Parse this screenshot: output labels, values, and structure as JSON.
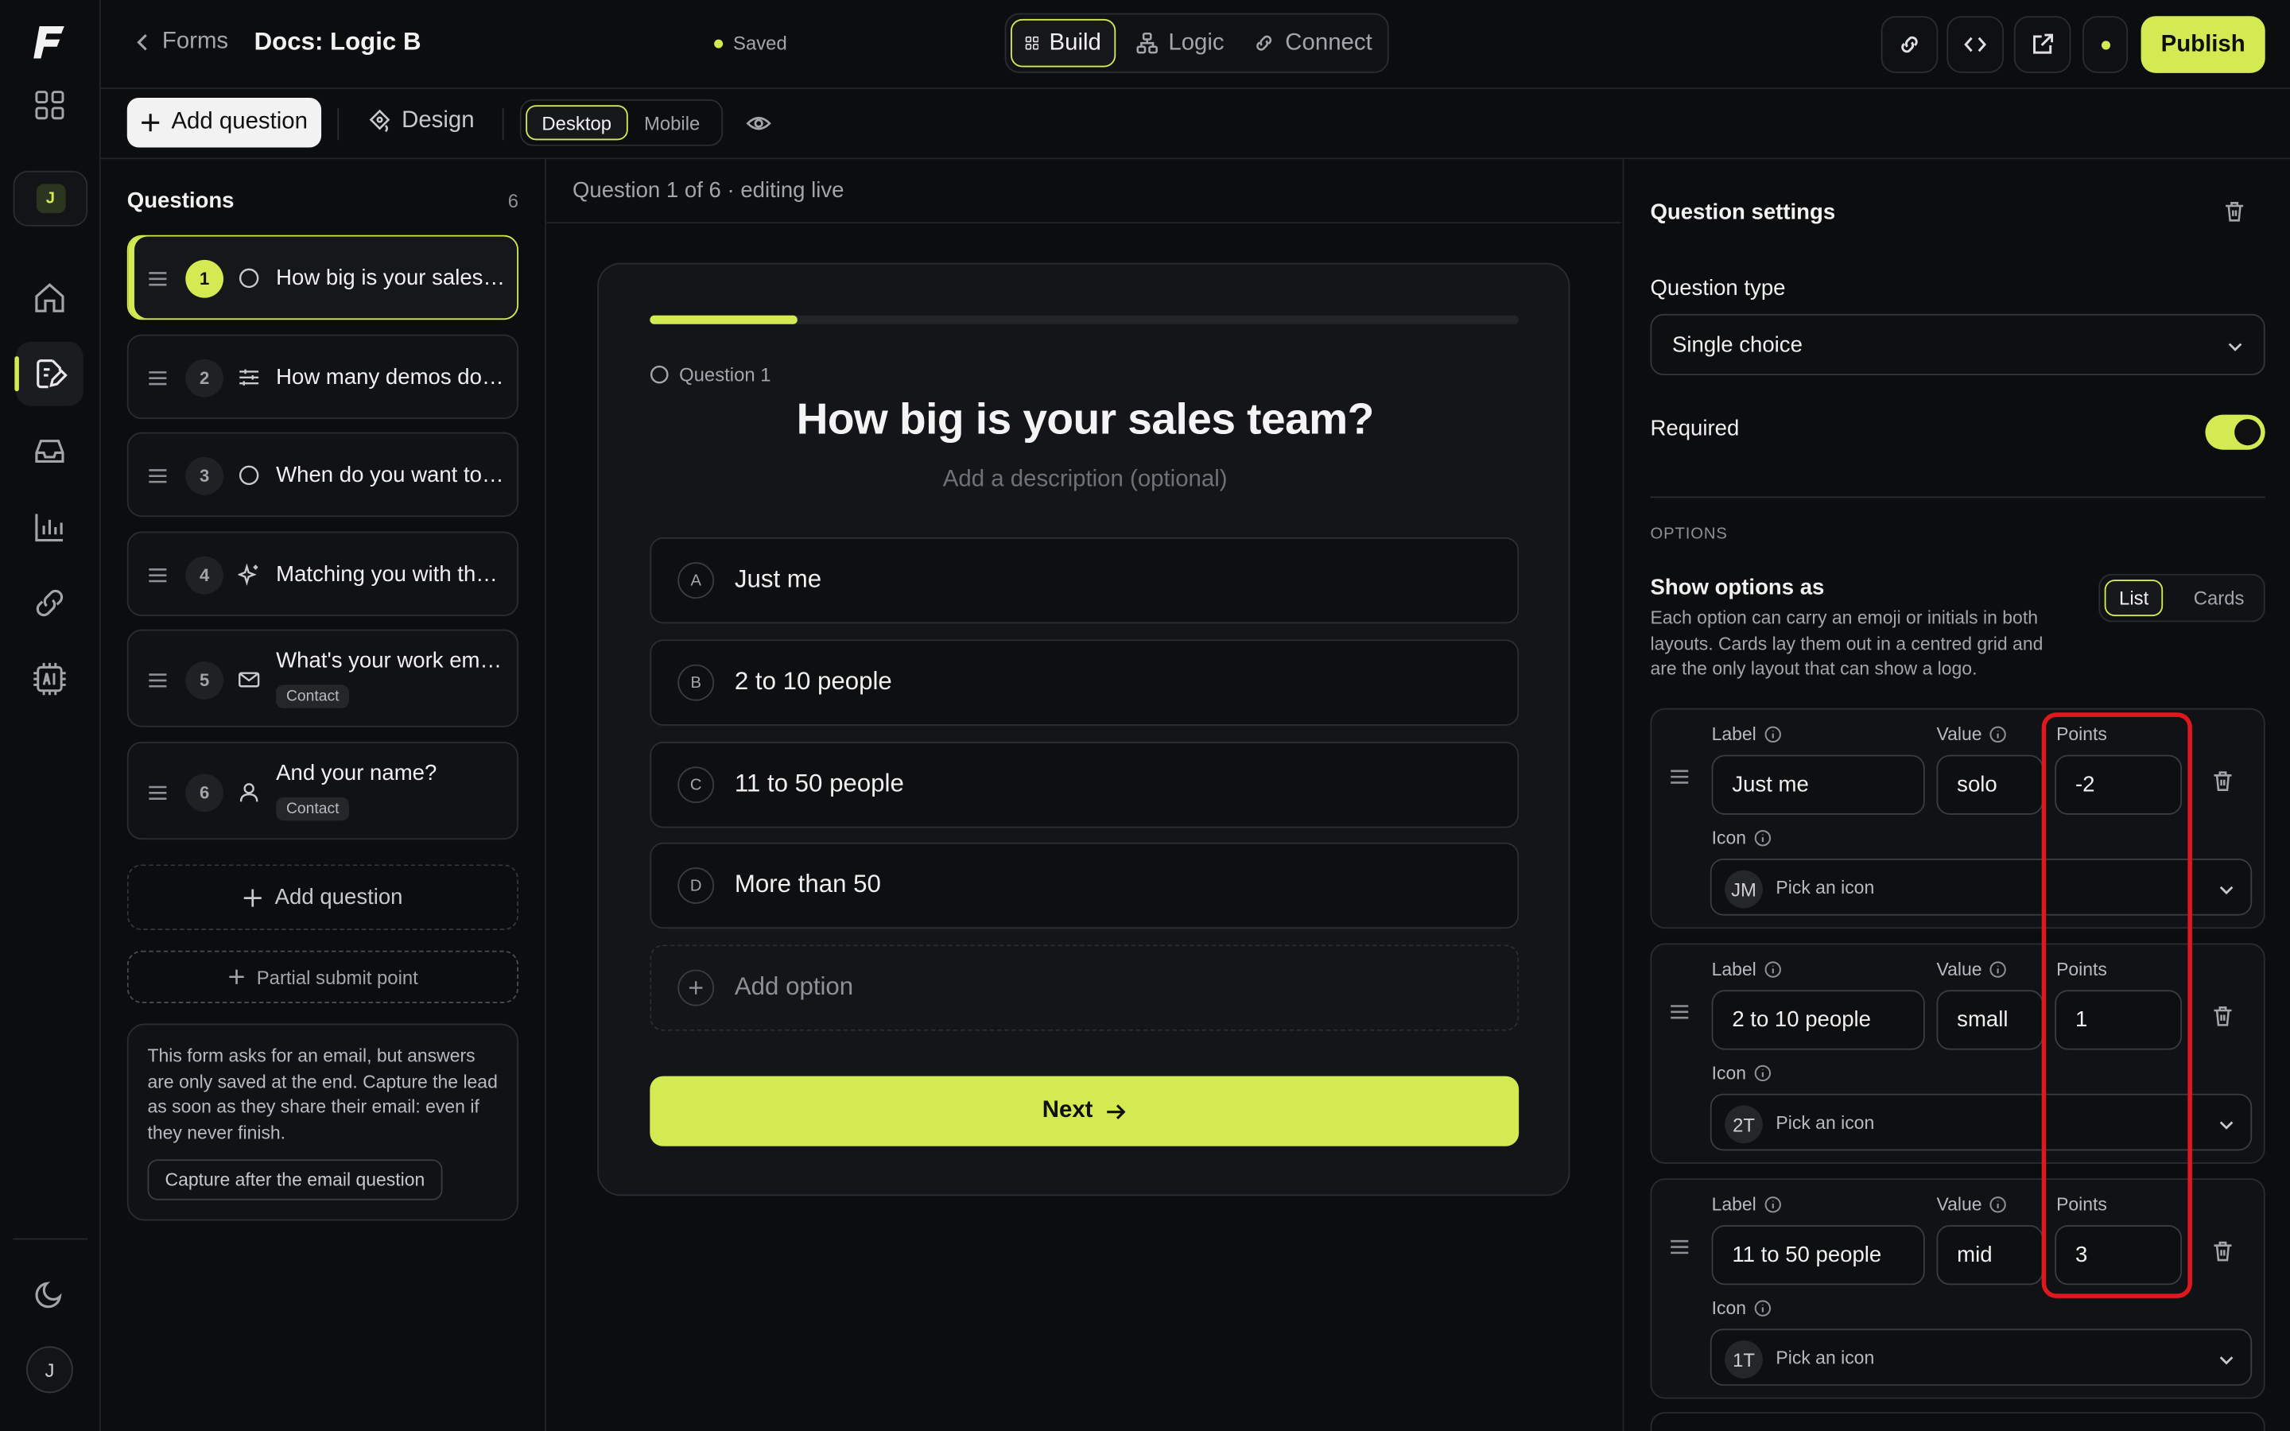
{
  "app": {
    "logo": "F"
  },
  "rail": {
    "workspace_initial": "J",
    "user_initial": "J",
    "items": [
      "apps-grid-icon",
      "home-icon",
      "forms-icon",
      "inbox-icon",
      "analytics-icon",
      "integrations-icon",
      "ai-icon"
    ]
  },
  "header": {
    "back_label": "Forms",
    "doc_title": "Docs: Logic B",
    "saved_status": "Saved",
    "modes": [
      "Build",
      "Logic",
      "Connect"
    ],
    "active_mode": "Build",
    "publish_label": "Publish"
  },
  "toolbar": {
    "add_question": "Add question",
    "design": "Design",
    "devices": [
      "Desktop",
      "Mobile"
    ],
    "active_device": "Desktop"
  },
  "questions_panel": {
    "title": "Questions",
    "count": "6",
    "items": [
      {
        "num": "1",
        "text": "How big is your sales team?",
        "icon": "radio-icon",
        "tag": ""
      },
      {
        "num": "2",
        "text": "How many demos do you run?",
        "icon": "sliders-icon",
        "tag": ""
      },
      {
        "num": "3",
        "text": "When do you want to start?",
        "icon": "radio-icon",
        "tag": ""
      },
      {
        "num": "4",
        "text": "Matching you with the right plan",
        "icon": "sparkle-icon",
        "tag": ""
      },
      {
        "num": "5",
        "text": "What's your work email?",
        "icon": "mail-icon",
        "tag": "Contact"
      },
      {
        "num": "6",
        "text": "And your name?",
        "icon": "user-icon",
        "tag": "Contact"
      }
    ],
    "add_question": "Add question",
    "partial_submit": "Partial submit point",
    "note_text": "This form asks for an email, but answers are only saved at the end. Capture the lead as soon as they share their email: even if they never finish.",
    "note_button": "Capture after the email question"
  },
  "preview": {
    "status": "Question 1 of 6 · editing live",
    "progress": 0.17,
    "question_label": "Question 1",
    "title": "How big is your sales team?",
    "description_placeholder": "Add a description (optional)",
    "options": [
      {
        "key": "A",
        "label": "Just me"
      },
      {
        "key": "B",
        "label": "2 to 10 people"
      },
      {
        "key": "C",
        "label": "11 to 50 people"
      },
      {
        "key": "D",
        "label": "More than 50"
      }
    ],
    "add_option": "Add option",
    "next_label": "Next"
  },
  "settings": {
    "title": "Question settings",
    "question_type_label": "Question type",
    "question_type_value": "Single choice",
    "required_label": "Required",
    "required_on": true,
    "options_section": "OPTIONS",
    "show_as_label": "Show options as",
    "show_as_help": "Each option can carry an emoji or initials in both layouts. Cards lay them out in a centred grid and are the only layout that can show a logo.",
    "layouts": [
      "List",
      "Cards"
    ],
    "active_layout": "List",
    "field_labels": {
      "label": "Label",
      "value": "Value",
      "points": "Points",
      "icon": "Icon"
    },
    "icon_placeholder": "Pick an icon",
    "option_rows": [
      {
        "label": "Just me",
        "value": "solo",
        "points": "-2",
        "initials": "JM"
      },
      {
        "label": "2 to 10 people",
        "value": "small",
        "points": "1",
        "initials": "2T"
      },
      {
        "label": "11 to 50 people",
        "value": "mid",
        "points": "3",
        "initials": "1T"
      }
    ]
  },
  "colors": {
    "accent": "#d4ea52",
    "background": "#0c0d0f",
    "highlight": "#e0181d"
  }
}
